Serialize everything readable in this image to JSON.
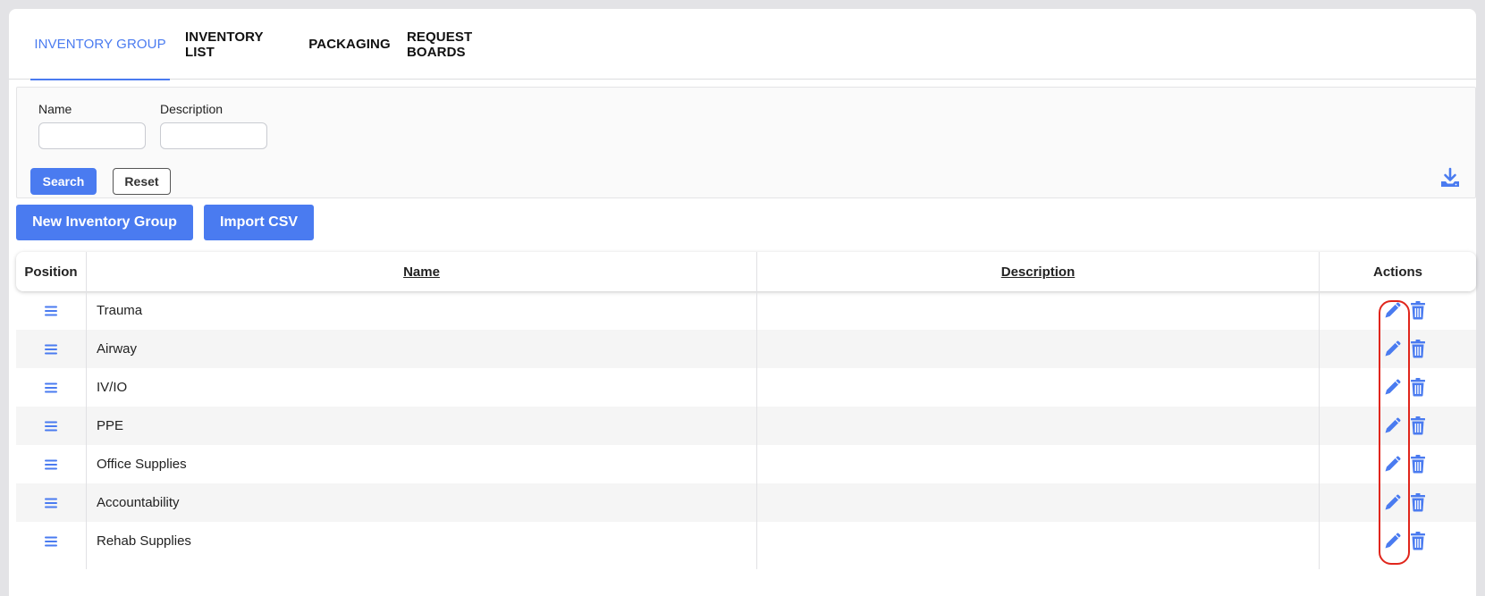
{
  "tabs": [
    {
      "label": "INVENTORY GROUP",
      "active": true
    },
    {
      "label": "INVENTORY LIST",
      "active": false
    },
    {
      "label": "PACKAGING",
      "active": false
    },
    {
      "label": "REQUEST BOARDS",
      "active": false
    }
  ],
  "filter": {
    "name_label": "Name",
    "name_value": "",
    "description_label": "Description",
    "description_value": "",
    "search_label": "Search",
    "reset_label": "Reset",
    "download_icon": "download-icon"
  },
  "actions": {
    "new_group_label": "New Inventory Group",
    "import_csv_label": "Import CSV"
  },
  "table": {
    "columns": [
      "Position",
      "Name",
      "Description",
      "Actions"
    ],
    "rows": [
      {
        "name": "Trauma",
        "description": ""
      },
      {
        "name": "Airway",
        "description": ""
      },
      {
        "name": "IV/IO",
        "description": ""
      },
      {
        "name": "PPE",
        "description": ""
      },
      {
        "name": "Office Supplies",
        "description": ""
      },
      {
        "name": "Accountability",
        "description": ""
      },
      {
        "name": "Rehab Supplies",
        "description": ""
      }
    ],
    "row_icons": {
      "drag": "drag-handle-icon",
      "edit": "pencil-icon",
      "delete": "trash-icon"
    }
  },
  "colors": {
    "accent": "#4a7bf0",
    "highlight": "#e0261c",
    "row_alt": "#f5f5f5"
  }
}
